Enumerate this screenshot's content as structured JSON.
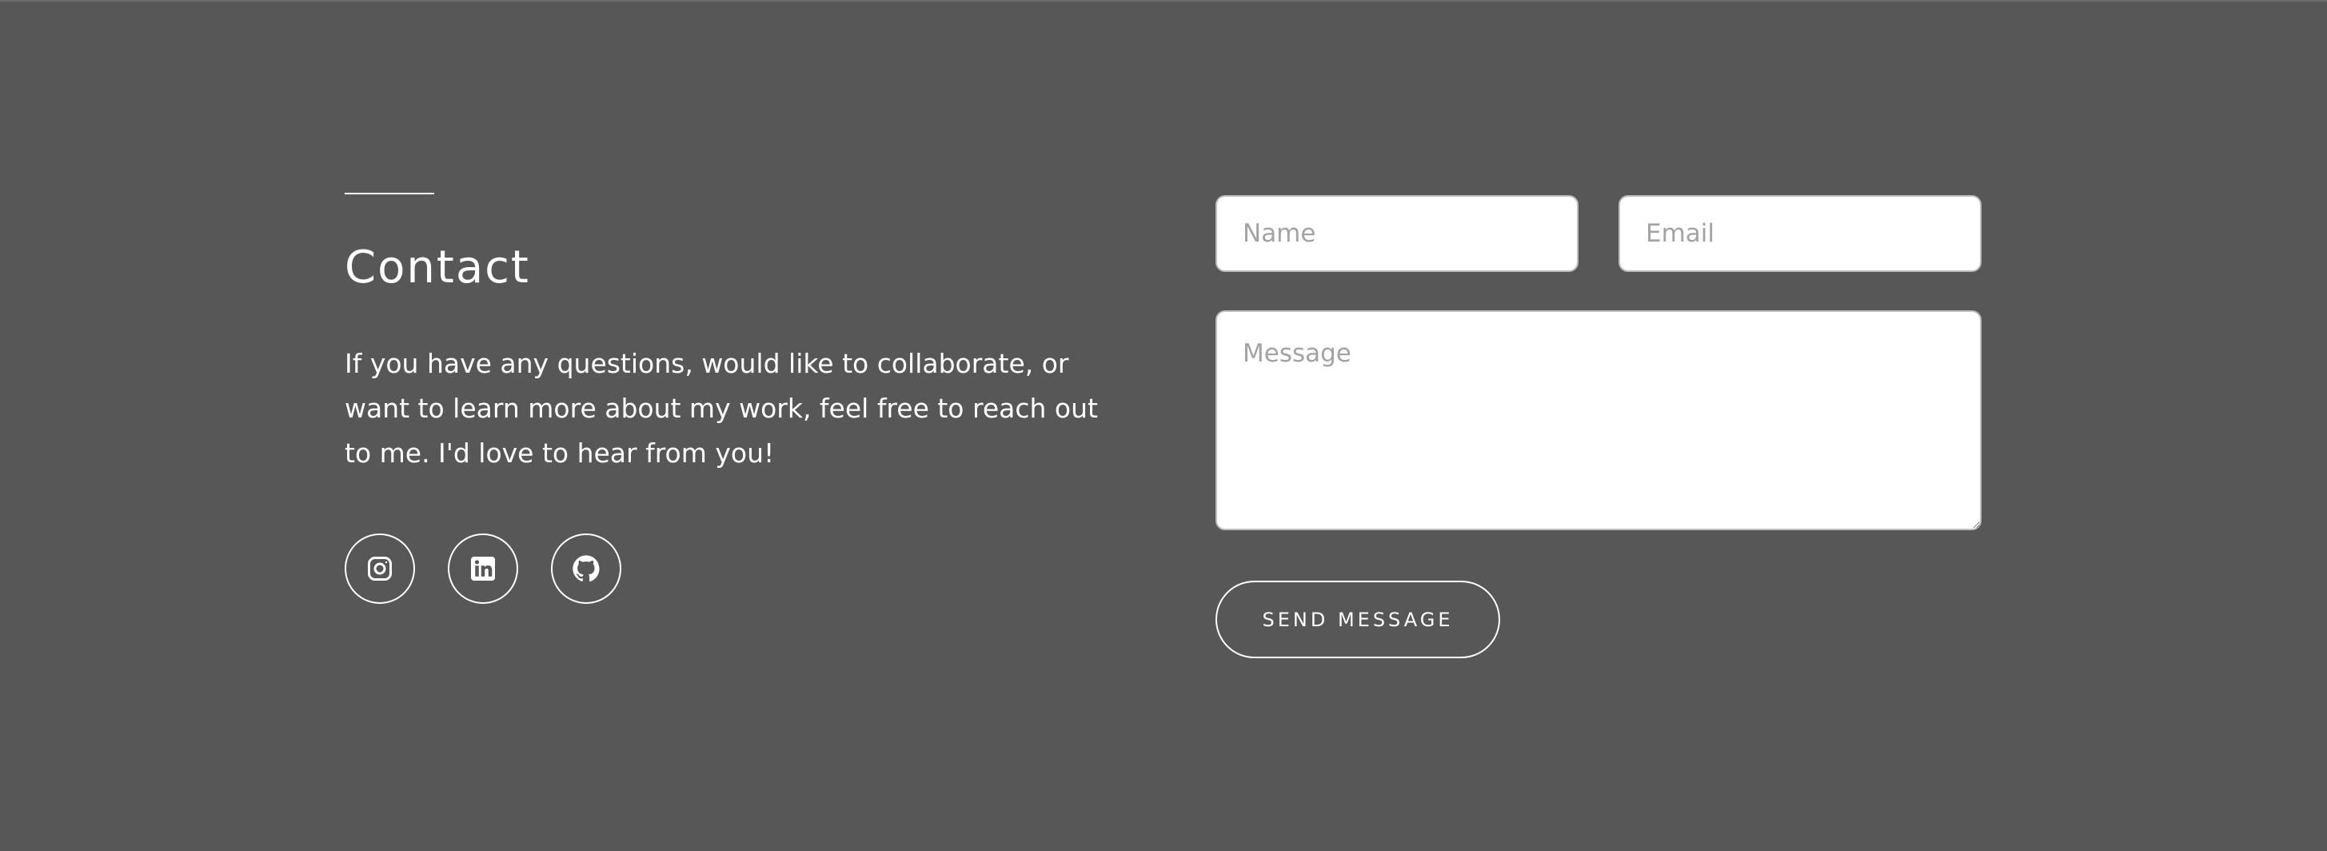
{
  "contact": {
    "title": "Contact",
    "description": "If you have any questions, would like to collaborate, or want to learn more about my work, feel free to reach out to me. I'd love to hear from you!",
    "socials": [
      {
        "icon": "instagram-icon"
      },
      {
        "icon": "linkedin-icon"
      },
      {
        "icon": "github-icon"
      }
    ]
  },
  "form": {
    "name_placeholder": "Name",
    "email_placeholder": "Email",
    "message_placeholder": "Message",
    "send_label": "SEND MESSAGE"
  },
  "colors": {
    "background": "#575757",
    "text": "#ffffff",
    "field_background": "#ffffff",
    "placeholder": "#a3a3a3"
  }
}
